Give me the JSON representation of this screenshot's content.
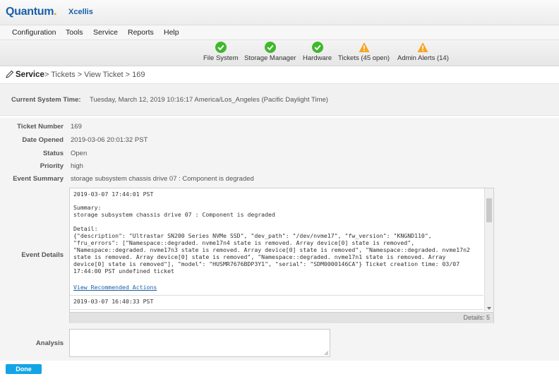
{
  "header": {
    "brand": "Quantum",
    "brand_dot": ".",
    "product": "Xcellis"
  },
  "menu": [
    "Configuration",
    "Tools",
    "Service",
    "Reports",
    "Help"
  ],
  "status": [
    {
      "label": "File System",
      "state": "ok"
    },
    {
      "label": "Storage Manager",
      "state": "ok"
    },
    {
      "label": "Hardware",
      "state": "ok"
    },
    {
      "label": "Tickets (45 open)",
      "state": "warning"
    },
    {
      "label": "Admin Alerts (14)",
      "state": "warning"
    }
  ],
  "colors": {
    "ok": "#3fb82c",
    "warning": "#f5a623",
    "accent": "#13a4e6",
    "brand": "#1a5fa8"
  },
  "breadcrumb": {
    "section": "Service",
    "path": "> Tickets > View Ticket > 169"
  },
  "system_time": {
    "label": "Current System Time:",
    "value": "Tuesday, March 12, 2019 10:16:17 America/Los_Angeles (Pacific Daylight Time)"
  },
  "ticket": {
    "number_label": "Ticket Number",
    "number": "169",
    "opened_label": "Date Opened",
    "opened": "2019-03-06 20:01:32 PST",
    "status_label": "Status",
    "status": "Open",
    "priority_label": "Priority",
    "priority": "high",
    "summary_label": "Event Summary",
    "summary": "storage subsystem chassis drive 07 : Component is degraded",
    "details_label": "Event Details",
    "analysis_label": "Analysis"
  },
  "event_details": {
    "entry1": {
      "timestamp": "2019-03-07 17:44:01 PST",
      "body": "Summary:\nstorage subsystem chassis drive 07 : Component is degraded\n\nDetail:\n{\"description\": \"Ultrastar SN200 Series NVMe SSD\", \"dev_path\": \"/dev/nvme17\", \"fw_version\": \"KNGND110\", \"fru_errors\": [\"Namespace::degraded. nvme17n4 state is removed. Array device[0] state is removed\", \"Namespace::degraded. nvme17n3 state is removed. Array device[0] state is removed\", \"Namespace::degraded. nvme17n2 state is removed. Array device[0] state is removed\", \"Namespace::degraded. nvme17n1 state is removed. Array device[0] state is removed\"], \"model\": \"HUSMR7676BDP3Y1\", \"serial\": \"SDM0000146CA\"} Ticket creation time: 03/07 17:44:00 PST undefined ticket",
      "link": "View Recommended Actions"
    },
    "entry2": {
      "timestamp": "2019-03-07 16:40:33 PST"
    },
    "footer": "Details: 5"
  },
  "actions": {
    "done": "Done"
  }
}
